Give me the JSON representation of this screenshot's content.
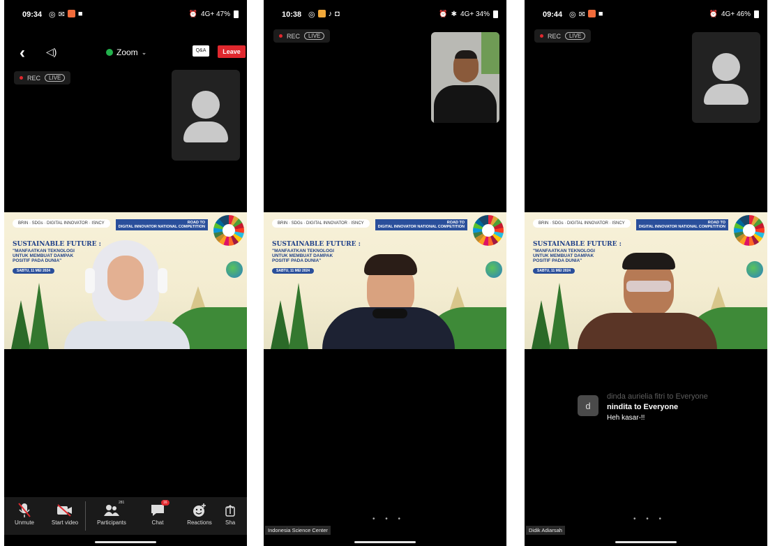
{
  "phones": [
    {
      "status": {
        "time": "09:34",
        "right": "4G+ 47%"
      },
      "header": {
        "zoom_label": "Zoom",
        "qa_label": "Q&A",
        "leave_label": "Leave"
      },
      "rec": {
        "rec_label": "REC",
        "live_label": "LIVE"
      },
      "controls": [
        {
          "label": "Unmute",
          "icon": "mic-off-icon"
        },
        {
          "label": "Start video",
          "icon": "video-off-icon"
        },
        {
          "label": "Participants",
          "icon": "participants-icon",
          "badge": "281"
        },
        {
          "label": "Chat",
          "icon": "chat-icon",
          "badge": "16"
        },
        {
          "label": "Reactions",
          "icon": "reactions-icon"
        },
        {
          "label": "Sha",
          "icon": "share-icon"
        }
      ]
    },
    {
      "status": {
        "time": "10:38",
        "right": "4G+ 34%"
      },
      "rec": {
        "rec_label": "REC",
        "live_label": "LIVE"
      },
      "name_tag": "Indonesia Science Center"
    },
    {
      "status": {
        "time": "09:44",
        "right": "4G+ 46%"
      },
      "rec": {
        "rec_label": "REC",
        "live_label": "LIVE"
      },
      "chat": {
        "avatar_letter": "d",
        "ghost_text": "dinda aurielia fitri to Everyone",
        "sender": "nindita to Everyone",
        "message": "Heh kasar-!!"
      },
      "name_tag": "Didik Adiarsah"
    }
  ],
  "slide": {
    "logos": "BRIN · SDGs · DIGITAL INNOVATOR · ISNCY",
    "road_to": "ROAD TO",
    "competition": "DIGITAL INNOVATOR NATIONAL COMPETITION",
    "title": "SUSTAINABLE FUTURE :",
    "subtitle": "\"MANFAATKAN TEKNOLOGI UNTUK MEMBUAT DAMPAK POSITIF PADA DUNIA\"",
    "date": "SABTU, 11 MEI 2024",
    "sdg_label": "GOALS"
  },
  "colors": {
    "leave": "#e0282e",
    "rec_dot": "#e0282e",
    "zoom_shield": "#22b14c",
    "slide_blue": "#1e3f88"
  }
}
